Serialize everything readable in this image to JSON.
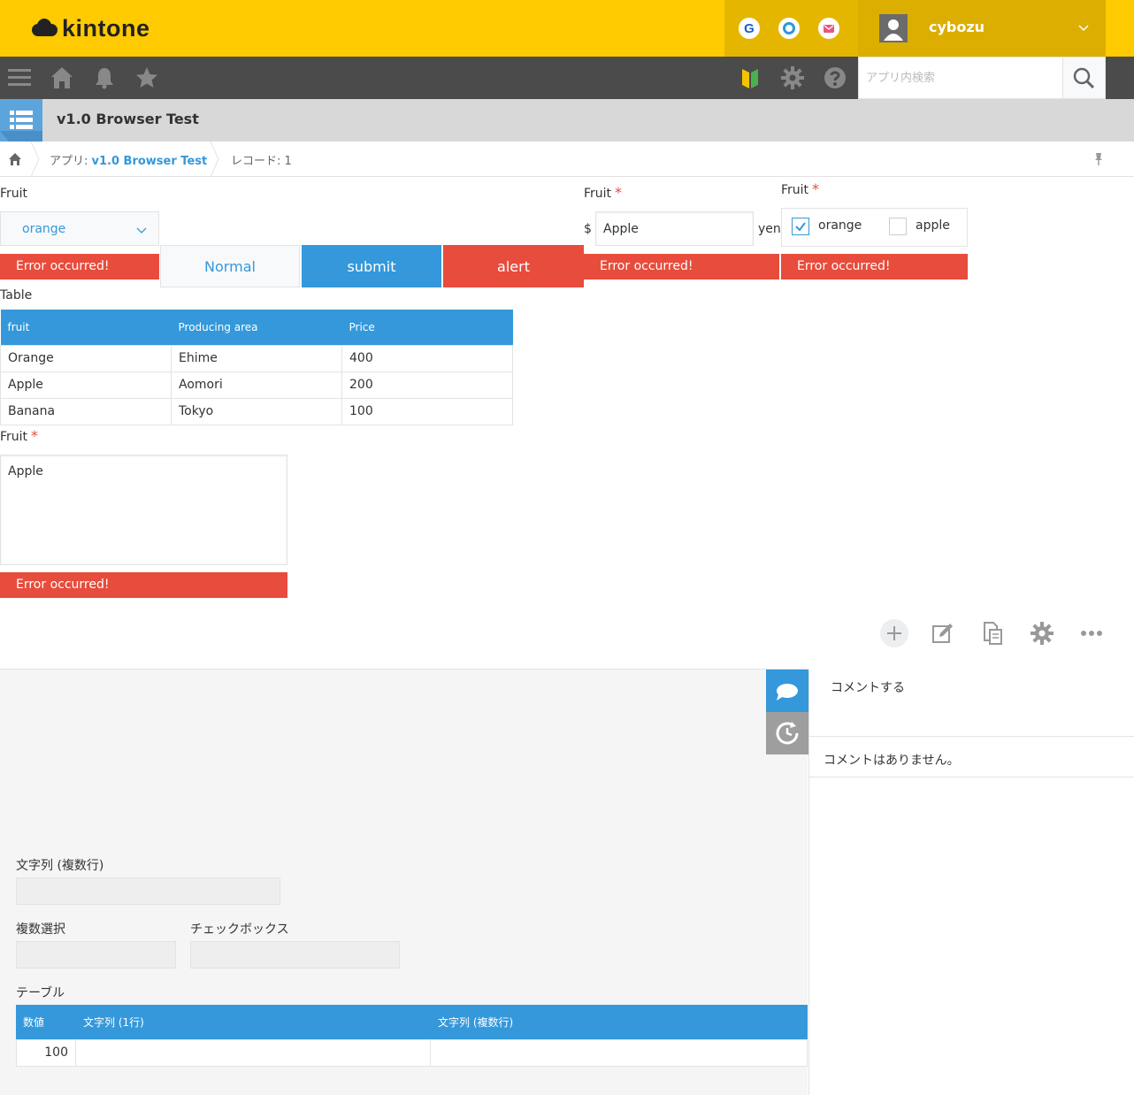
{
  "header": {
    "logo_text": "kintone",
    "services": [
      "G",
      "O",
      "M"
    ],
    "username": "cybozu"
  },
  "nav": {
    "search_placeholder": "アプリ内検索"
  },
  "app": {
    "title": "v1.0 Browser Test"
  },
  "breadcrumb": {
    "app_prefix": "アプリ: ",
    "app_name": "v1.0 Browser Test",
    "record": "レコード: 1"
  },
  "form": {
    "dropdown": {
      "label": "Fruit",
      "value": "orange",
      "error": "Error occurred!"
    },
    "buttons": {
      "normal": "Normal",
      "submit": "submit",
      "alert": "alert"
    },
    "text_field": {
      "label": "Fruit",
      "required_mark": "*",
      "prefix": "$",
      "value": "Apple",
      "suffix": "yen",
      "error": "Error occurred!"
    },
    "checkbox": {
      "label": "Fruit",
      "required_mark": "*",
      "options": [
        {
          "label": "orange",
          "checked": true
        },
        {
          "label": "apple",
          "checked": false
        }
      ],
      "error": "Error occurred!"
    },
    "table": {
      "label": "Table",
      "headers": [
        "fruit",
        "Producing area",
        "Price"
      ],
      "rows": [
        [
          "Orange",
          "Ehime",
          "400"
        ],
        [
          "Apple",
          "Aomori",
          "200"
        ],
        [
          "Banana",
          "Tokyo",
          "100"
        ]
      ]
    },
    "textarea": {
      "label": "Fruit",
      "required_mark": "*",
      "value": "Apple",
      "error": "Error occurred!"
    }
  },
  "lower": {
    "multiline_label": "文字列 (複数行)",
    "multiselect_label": "複数選択",
    "checkbox_label": "チェックボックス",
    "table_label": "テーブル",
    "subtable_headers": [
      "数値",
      "文字列 (1行)",
      "文字列 (複数行)"
    ],
    "subtable_row": [
      "100",
      "",
      ""
    ]
  },
  "comments": {
    "placeholder": "コメントする",
    "empty": "コメントはありません。"
  },
  "colors": {
    "header_bg": "#ffcb00",
    "accent": "#3498db",
    "error": "#e74c3c",
    "nav_bg": "#4b4b4b"
  }
}
